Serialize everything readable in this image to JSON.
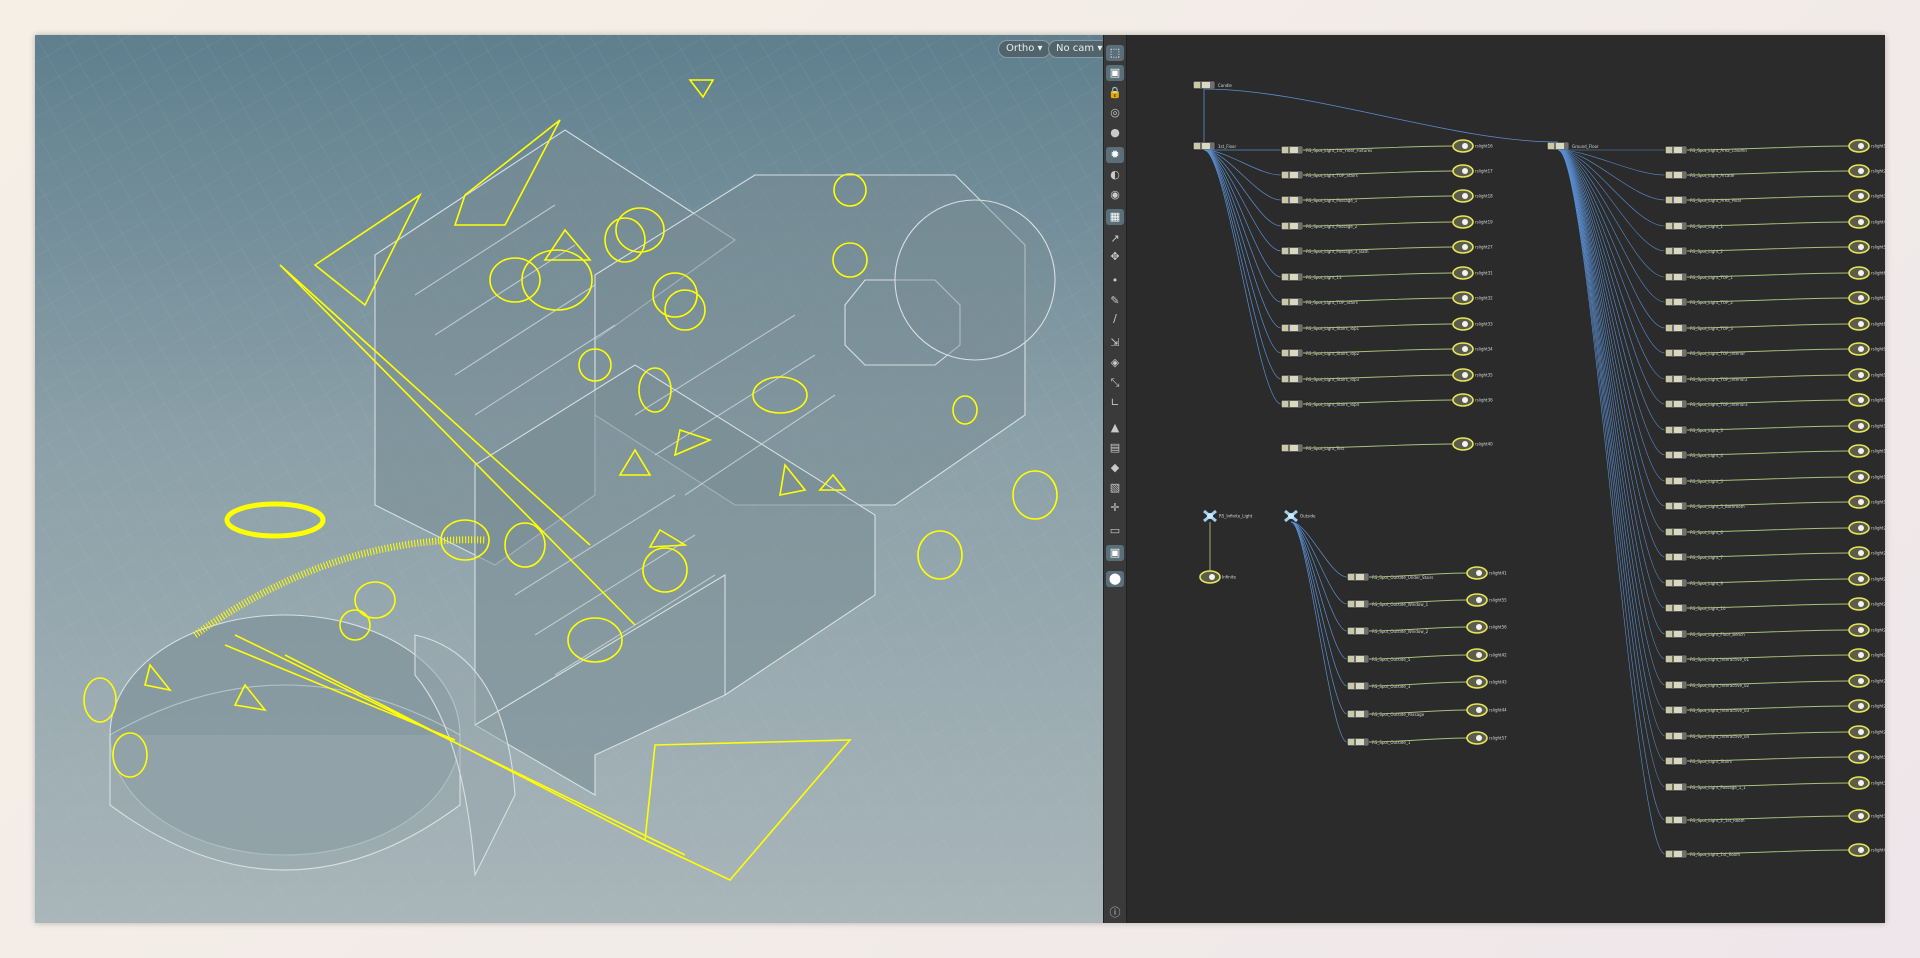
{
  "viewport": {
    "view_mode": "Ortho",
    "camera": "No cam",
    "colors": {
      "guide": "#ffff00",
      "geometry": "#d5dde0"
    }
  },
  "toolbar": {
    "tools": [
      {
        "icon": "select-icon",
        "active": true
      },
      {
        "icon": "snap-icon",
        "active": true
      },
      {
        "icon": "lock-icon",
        "active": false
      },
      {
        "icon": "wireframe-icon",
        "active": false
      },
      {
        "icon": "shading-icon",
        "active": false
      },
      {
        "icon": "light-icon",
        "active": true
      },
      {
        "icon": "bulb-icon",
        "active": false
      },
      {
        "icon": "camera-icon",
        "active": false
      },
      {
        "icon": "grid-icon",
        "active": true
      },
      {
        "icon": "handle-icon",
        "active": false
      },
      {
        "icon": "transform-icon",
        "active": false
      },
      {
        "icon": "point-icon",
        "active": false
      },
      {
        "icon": "brush-icon",
        "active": false
      },
      {
        "icon": "pen-icon",
        "active": false
      },
      {
        "icon": "measure-icon",
        "active": false
      },
      {
        "icon": "paint-icon",
        "active": false
      },
      {
        "icon": "scale-icon",
        "active": false
      },
      {
        "icon": "angle-icon",
        "active": false
      },
      {
        "icon": "terrain-icon",
        "active": false
      },
      {
        "icon": "texture-icon",
        "active": false
      },
      {
        "icon": "material-icon",
        "active": false
      },
      {
        "icon": "image-icon",
        "active": false
      },
      {
        "icon": "axis-icon",
        "active": false
      },
      {
        "icon": "display-icon",
        "active": false
      },
      {
        "icon": "render-icon",
        "active": true
      },
      {
        "icon": "pin-icon",
        "active": true
      }
    ],
    "info_icon": "info-icon"
  },
  "network": {
    "colors": {
      "wire_blue": "#5a8fd1",
      "wire_green": "#a8c07a",
      "node": "#c9c9a6",
      "node_yellow": "#e6e65a"
    },
    "roots": [
      {
        "id": "root-cam",
        "label": "Candle",
        "type": "transform",
        "col": "a"
      },
      {
        "id": "root-1st",
        "label": "1st_Floor",
        "type": "transform",
        "col": "a"
      },
      {
        "id": "root-ground",
        "label": "Ground_Floor",
        "type": "transform",
        "col": "b"
      },
      {
        "id": "root-infinite",
        "label": "RS_Infinite_Light",
        "type": "light",
        "col": "a"
      },
      {
        "id": "root-outside",
        "label": "Outside",
        "type": "light",
        "col": "a"
      }
    ],
    "group_1st": [
      {
        "label": "RS_Spot_Light_1st_Floor_Fixtures",
        "out": "rslight16"
      },
      {
        "label": "RS_Spot_Light_TOP_Stairs",
        "out": "rslight17"
      },
      {
        "label": "RS_Spot_Light_Passage_1",
        "out": "rslight18"
      },
      {
        "label": "RS_Spot_Light_Passage_2",
        "out": "rslight19"
      },
      {
        "label": "RS_Spot_Light_Passage_3_Bath",
        "out": "rslight27"
      },
      {
        "label": "RS_Spot_Light_13",
        "out": "rslight31"
      },
      {
        "label": "RS_Spot_Light_TOP_Stairs",
        "out": "rslight32"
      },
      {
        "label": "RS_Spot_Light_Stairs_Top1",
        "out": "rslight33"
      },
      {
        "label": "RS_Spot_Light_Stairs_Top2",
        "out": "rslight34"
      },
      {
        "label": "RS_Spot_Light_Stairs_Top3",
        "out": "rslight35"
      },
      {
        "label": "RS_Spot_Light_Stairs_Top4",
        "out": "rslight36"
      },
      {
        "label": "RS_Spot_Light_Test",
        "out": "rslight40"
      }
    ],
    "infinite_out": "Infinite",
    "group_outside": [
      {
        "label": "RS_Spot_Outside_Under_Stairs",
        "out": "rslight41"
      },
      {
        "label": "RS_Spot_Outside_Window_1",
        "out": "rslight55"
      },
      {
        "label": "RS_Spot_Outside_Window_2",
        "out": "rslight56"
      },
      {
        "label": "RS_Spot_Outside_5",
        "out": "rslight42"
      },
      {
        "label": "RS_Spot_Outside_3",
        "out": "rslight43"
      },
      {
        "label": "RS_Spot_Outside_Passage",
        "out": "rslight44"
      },
      {
        "label": "RS_Spot_Outside_1",
        "out": "rslight57"
      }
    ],
    "group_ground": [
      {
        "label": "RS_Spot_Light_Area_Column",
        "out": "rslight1"
      },
      {
        "label": "RS_Spot_Light_Arcade",
        "out": "rslight2"
      },
      {
        "label": "RS_Spot_Light_Area_Pillar",
        "out": "rslight3"
      },
      {
        "label": "RS_Spot_Light_1",
        "out": "rslight4"
      },
      {
        "label": "RS_Spot_Light_2",
        "out": "rslight5"
      },
      {
        "label": "RS_Spot_Light_TOP_1",
        "out": "rslight6"
      },
      {
        "label": "RS_Spot_Light_TOP_2",
        "out": "rslight7"
      },
      {
        "label": "RS_Spot_Light_TOP_3",
        "out": "rslight8"
      },
      {
        "label": "RS_Spot_Light_TOP_Interior",
        "out": "rslight9"
      },
      {
        "label": "RS_Spot_Light_TOP_Interior2",
        "out": "rslight10"
      },
      {
        "label": "RS_Spot_Light_TOP_Interior3",
        "out": "rslight11"
      },
      {
        "label": "RS_Spot_Light_3",
        "out": "rslight12"
      },
      {
        "label": "RS_Spot_Light_4",
        "out": "rslight13"
      },
      {
        "label": "RS_Spot_Light_5",
        "out": "rslight14"
      },
      {
        "label": "RS_Spot_Light_5_Bathroom",
        "out": "rslight15"
      },
      {
        "label": "RS_Spot_Light_6",
        "out": "rslight20"
      },
      {
        "label": "RS_Spot_Light_7",
        "out": "rslight21"
      },
      {
        "label": "RS_Spot_Light_9",
        "out": "rslight22"
      },
      {
        "label": "RS_Spot_Light_10",
        "out": "rslight23"
      },
      {
        "label": "RS_Spot_Light_Floor_Bench",
        "out": "rslight24"
      },
      {
        "label": "RS_Spot_Light_Interactive_01",
        "out": "rslight25"
      },
      {
        "label": "RS_Spot_Light_Interactive_02",
        "out": "rslight26"
      },
      {
        "label": "RS_Spot_Light_Interactive_03",
        "out": "rslight28"
      },
      {
        "label": "RS_Spot_Light_Interactive_04",
        "out": "rslight29"
      },
      {
        "label": "RS_Spot_Light_Stairs",
        "out": "rslight30"
      },
      {
        "label": "RS_Spot_Light_Passage_1_1",
        "out": "rslight38"
      },
      {
        "label": "RS_Spot_Light_2_1st_Room",
        "out": "rslight39"
      },
      {
        "label": "RS_Spot_Light_1st_Room",
        "out": "rslight45"
      }
    ]
  }
}
